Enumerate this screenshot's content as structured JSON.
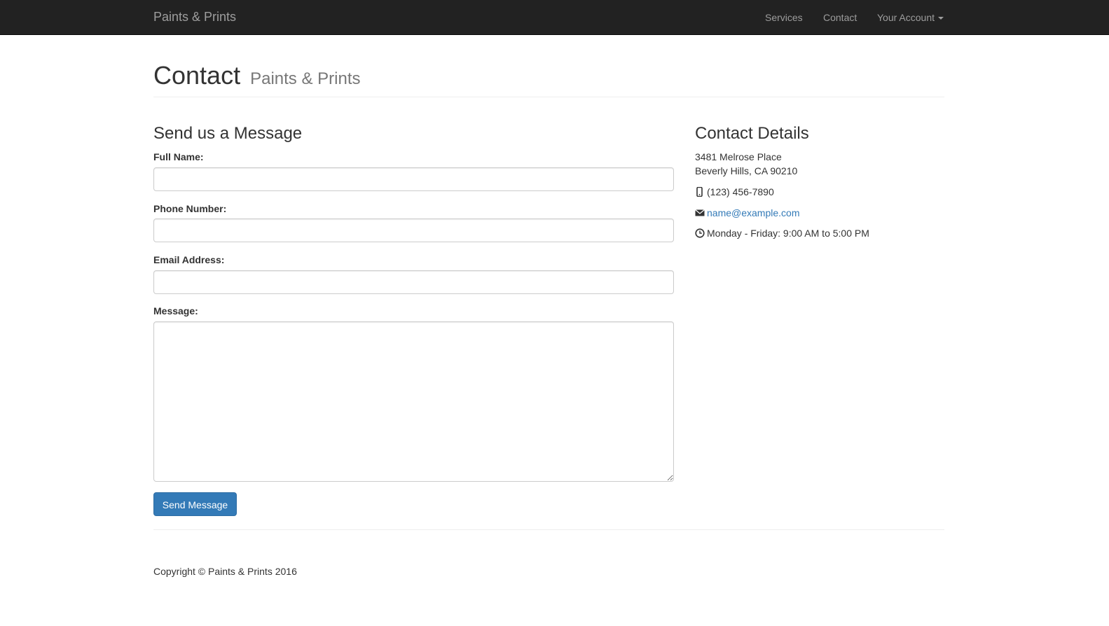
{
  "navbar": {
    "brand": "Paints & Prints",
    "links": [
      {
        "label": "Services"
      },
      {
        "label": "Contact"
      },
      {
        "label": "Your Account"
      }
    ]
  },
  "page": {
    "title": "Contact",
    "subtitle": "Paints & Prints"
  },
  "form": {
    "heading": "Send us a Message",
    "full_name_label": "Full Name:",
    "full_name_value": "",
    "phone_label": "Phone Number:",
    "phone_value": "",
    "email_label": "Email Address:",
    "email_value": "",
    "message_label": "Message:",
    "message_value": "",
    "submit_label": "Send Message"
  },
  "details": {
    "heading": "Contact Details",
    "address_line1": "3481 Melrose Place",
    "address_line2": "Beverly Hills, CA 90210",
    "phone": "(123) 456-7890",
    "email": "name@example.com",
    "hours": "Monday - Friday: 9:00 AM to 5:00 PM",
    "icons": [
      "phone-icon",
      "envelope-icon",
      "clock-icon"
    ]
  },
  "footer": {
    "copyright": "Copyright © Paints & Prints 2016"
  },
  "colors": {
    "navbar_bg": "#222222",
    "nav_text": "#9d9d9d",
    "primary": "#337ab7",
    "link": "#337ab7"
  }
}
